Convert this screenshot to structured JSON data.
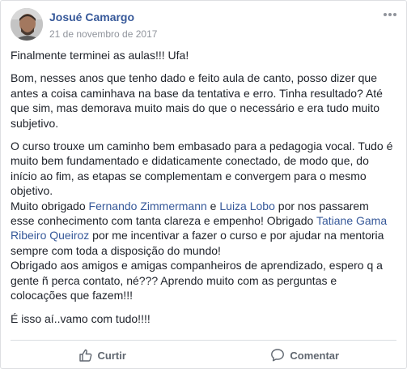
{
  "post": {
    "author": "Josué Camargo",
    "date": "21 de novembro de 2017",
    "p1": "Finalmente terminei as aulas!!! Ufa!",
    "p2": "Bom, nesses anos que tenho dado e feito aula de canto, posso dizer que antes a coisa caminhava na base da tentativa e erro. Tinha resultado? Até que sim, mas demorava muito mais do que o necessário e era tudo muito subjetivo.",
    "p3": "O curso trouxe um caminho bem embasado para a pedagogia vocal. Tudo é muito bem fundamentado e didaticamente conectado, de modo que, do início ao fim, as etapas se complementam e convergem para o mesmo objetivo.",
    "p4a": "Muito obrigado ",
    "mention1": "Fernando Zimmermann",
    "p4b": " e ",
    "mention2": "Luiza Lobo",
    "p4c": " por nos passarem esse conhecimento com tanta clareza e empenho! Obrigado ",
    "mention3": "Tatiane Gama Ribeiro Queiroz",
    "p4d": " por me incentivar a fazer o curso e por ajudar na mentoria sempre com toda a disposição do mundo!",
    "p5": "Obrigado aos amigos e amigas companheiros de aprendizado, espero q a gente ñ perca contato, né??? Aprendo muito com as perguntas e colocações que fazem!!!",
    "p6": "É isso aí..vamo com tudo!!!!"
  },
  "actions": {
    "like_label": "Curtir",
    "comment_label": "Comentar"
  },
  "icons": {
    "menu": "more-options-icon",
    "like": "thumbs-up-icon",
    "comment": "speech-bubble-icon"
  },
  "colors": {
    "link": "#365899",
    "text": "#1d2129",
    "muted": "#90949c"
  }
}
